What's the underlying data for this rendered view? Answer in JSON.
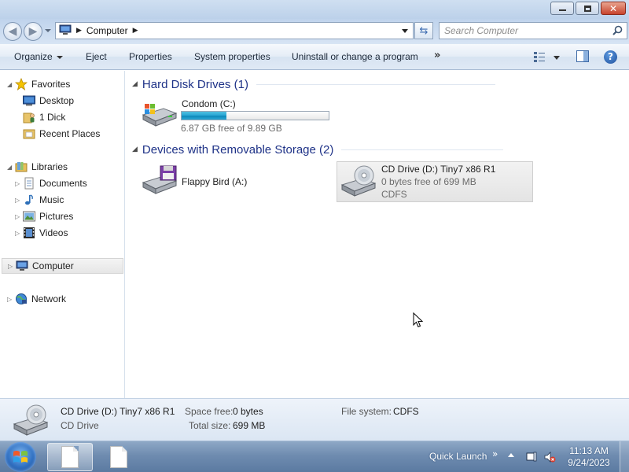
{
  "window": {
    "caption": {
      "minimize_icon": "minimize-icon",
      "maximize_icon": "restore-icon",
      "close_glyph": "✕"
    }
  },
  "address_bar": {
    "back_glyph": "◀",
    "forward_glyph": "▶",
    "crumbs": [
      "Computer"
    ],
    "separator": "▶",
    "refresh_glyph": "⇆"
  },
  "search": {
    "placeholder": "Search Computer"
  },
  "command_bar": {
    "organize": "Organize",
    "eject": "Eject",
    "properties": "Properties",
    "system_properties": "System properties",
    "uninstall": "Uninstall or change a program",
    "more": "»",
    "help": "?"
  },
  "nav_pane": {
    "favorites": {
      "label": "Favorites",
      "items": [
        "Desktop",
        "1 Dick",
        "Recent Places"
      ]
    },
    "libraries": {
      "label": "Libraries",
      "items": [
        "Documents",
        "Music",
        "Pictures",
        "Videos"
      ]
    },
    "computer": "Computer",
    "network": "Network",
    "expanded_glyph": "◢",
    "collapsed_glyph": "▷"
  },
  "content": {
    "groups": [
      {
        "title": "Hard Disk Drives (1)"
      },
      {
        "title": "Devices with Removable Storage (2)"
      }
    ],
    "hdd": {
      "name": "Condom (C:)",
      "free_text": "6.87 GB free of 9.89 GB",
      "used_fraction": 0.305
    },
    "floppy": {
      "name": "Flappy Bird (A:)"
    },
    "cd": {
      "name": "CD Drive (D:) Tiny7 x86 R1",
      "free_text": "0 bytes free of 699 MB",
      "fs": "CDFS"
    },
    "group_toggle_glyph": "◢"
  },
  "details": {
    "name": "CD Drive (D:) Tiny7 x86 R1",
    "type": "CD Drive",
    "space_free_label": "Space free:",
    "space_free": "0 bytes",
    "total_size_label": "Total size:",
    "total_size": "699 MB",
    "fs_label": "File system:",
    "fs": "CDFS"
  },
  "taskbar": {
    "quick_launch": "Quick Launch",
    "quick_chevron": "»",
    "time": "11:13 AM",
    "date": "9/24/2023"
  },
  "colors": {
    "group_heading": "#1e3287",
    "bar_fill": "#26a3d3",
    "taskbar": "#6f8cb0"
  }
}
